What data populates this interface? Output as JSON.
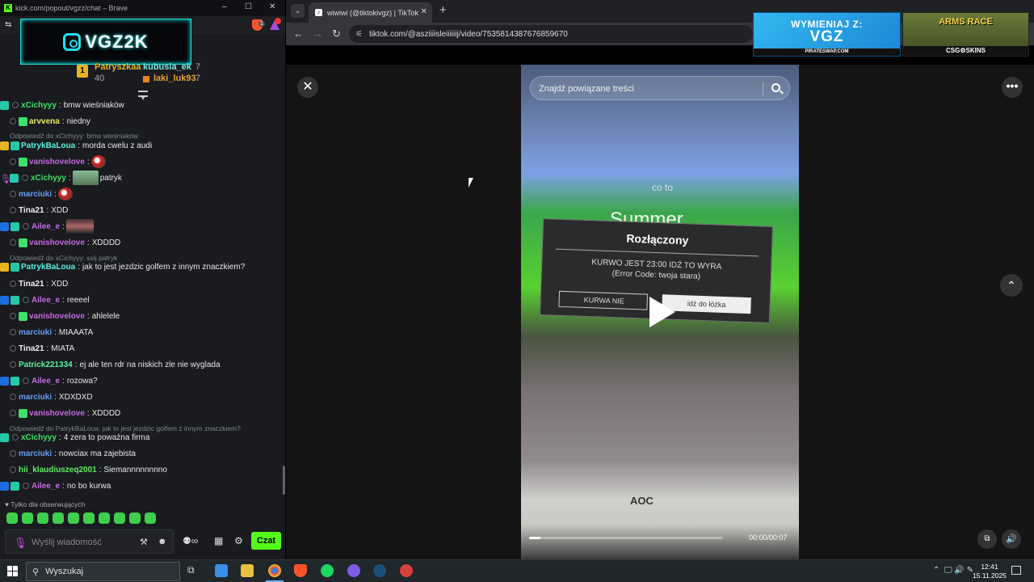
{
  "chat_window": {
    "title": "kick.com/popout/vgzz/chat – Brave",
    "channel_logo_text": "VGZ2K",
    "shield_count": "1",
    "podium": [
      {
        "rank": "1",
        "name": "Patryszkaa",
        "count": "7"
      },
      {
        "rank": "",
        "name": "kubusia_ek",
        "count": "7"
      },
      {
        "rank": "",
        "name": "40",
        "count": ""
      },
      {
        "rank": "",
        "name": "laki_luk93",
        "count": "7"
      }
    ],
    "messages": [
      {
        "user": "xCichyyy",
        "text": "bmw wieśniaków",
        "color": "#3ee06a"
      },
      {
        "user": "arvvena",
        "text": "niedny",
        "color": "#e8e860"
      },
      {
        "reply": "Odpowiedź do xCichyyy: bmw wieśniaków"
      },
      {
        "user": "PatrykBaLoua",
        "text": "morda cwelu z audi",
        "color": "#5cf0e0"
      },
      {
        "user": "vanishovelove",
        "text": "",
        "color": "#c46ae0"
      },
      {
        "user": "xCichyyy",
        "text": "patryk",
        "color": "#3ee06a"
      },
      {
        "user": "marciuki",
        "text": "",
        "color": "#6a9cf0"
      },
      {
        "user": "Tina21",
        "text": "XDD",
        "color": "#eeeeee"
      },
      {
        "user": "Ailee_e",
        "text": "",
        "color": "#c46ae0"
      },
      {
        "user": "vanishovelove",
        "text": "XDDDD",
        "color": "#c46ae0"
      },
      {
        "reply": "Odpowiedź do xCichyyy: ssij patryk"
      },
      {
        "user": "PatrykBaLoua",
        "text": "jak to jest jezdzic golfem z innym znaczkiem?",
        "color": "#5cf0e0"
      },
      {
        "user": "Tina21",
        "text": "XDD",
        "color": "#eeeeee"
      },
      {
        "user": "Ailee_e",
        "text": "reeeel",
        "color": "#c46ae0"
      },
      {
        "user": "vanishovelove",
        "text": "ahlelele",
        "color": "#c46ae0"
      },
      {
        "user": "marciuki",
        "text": "MIAAATA",
        "color": "#6a9cf0"
      },
      {
        "user": "Tina21",
        "text": "MIATA",
        "color": "#eeeeee"
      },
      {
        "user": "Patrick221334",
        "text": "ej ale ten rdr na niskich zle nie wyglada",
        "color": "#5cf0a0"
      },
      {
        "user": "Ailee_e",
        "text": "rozowa?",
        "color": "#c46ae0"
      },
      {
        "user": "marciuki",
        "text": "XDXDXD",
        "color": "#6a9cf0"
      },
      {
        "user": "vanishovelove",
        "text": "XDDDD",
        "color": "#c46ae0"
      },
      {
        "reply": "Odpowiedź do PatrykBaLoua: jak to jest jezdzic golfem z innym znaczkiem?"
      },
      {
        "user": "xCichyyy",
        "text": "4 zera to poważna firma",
        "color": "#3ee06a"
      },
      {
        "user": "marciuki",
        "text": "nowciax ma zajebista",
        "color": "#6a9cf0"
      },
      {
        "user": "hii_klaudiuszeq2001",
        "text": "Siemannnnnnnno",
        "color": "#5cf05c"
      },
      {
        "user": "Ailee_e",
        "text": "no bo kurwa",
        "color": "#c46ae0"
      }
    ],
    "followers_only": "Tylko dla obserwujących",
    "input_placeholder": "Wyślij wiadomość",
    "send_label": "Czat"
  },
  "browser": {
    "tab_title": "wiwiwi (@tiktokivgz) | TikTok",
    "url": "tiktok.com/@asziiiisleiiiiiij/video/7535814387676859670",
    "ad1": {
      "line1": "WYMIENIAJ Z:",
      "line2": "VGZ",
      "line3": "PIRATESWAP.COM"
    },
    "ad2": {
      "line1": "ARMS RACE",
      "line2": "CSG⚙SKINS"
    },
    "search_placeholder": "Znajdź powiązane treści",
    "video": {
      "caption_small": "co to",
      "caption_big": "Summer",
      "dialog_title": "Rozłączony",
      "dialog_body1": "KURWO JEST 23:00 IDŹ TO WYRA",
      "dialog_body2": "(Error Code: twoja stara)",
      "dialog_btn1": "KURWA NIE",
      "dialog_btn2": "idź do łóżka",
      "monitor_brand": "AOC"
    },
    "time": "00:00/00:07",
    "progress": 0.06
  },
  "taskbar": {
    "search_label": "Wyszukaj",
    "time": "12:41",
    "date": "15.11.2025"
  }
}
